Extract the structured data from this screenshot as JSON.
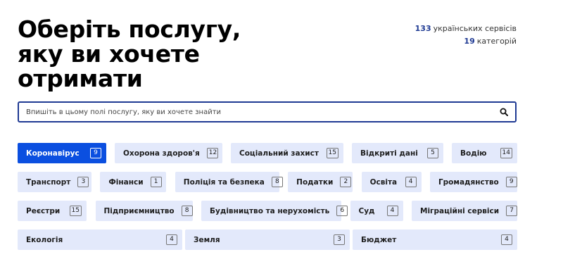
{
  "heading": {
    "line1": "Оберіть послугу,",
    "line2": "яку ви хочете",
    "line3": "отримати"
  },
  "stats": {
    "services_count": "133",
    "services_label": "українських сервісів",
    "categories_count": "19",
    "categories_label": "категорій"
  },
  "search": {
    "placeholder": "Впишіть в цьому полі послугу, яку ви хочете знайти",
    "value": "",
    "icon": "search-icon"
  },
  "colors": {
    "accent": "#0b4fe0",
    "chip_bg": "#e3e9fb",
    "search_border": "#1f3a93"
  },
  "categories": [
    {
      "label": "Коронавірус",
      "count": "9",
      "active": true
    },
    {
      "label": "Охорона здоров'я",
      "count": "12"
    },
    {
      "label": "Соціальний захист",
      "count": "15"
    },
    {
      "label": "Відкриті дані",
      "count": "5"
    },
    {
      "label": "Водію",
      "count": "14"
    },
    {
      "label": "Транспорт",
      "count": "3"
    },
    {
      "label": "Фінанси",
      "count": "1"
    },
    {
      "label": "Поліція та безпека",
      "count": "8"
    },
    {
      "label": "Податки",
      "count": "2"
    },
    {
      "label": "Освіта",
      "count": "4"
    },
    {
      "label": "Громадянство",
      "count": "9"
    },
    {
      "label": "Реєстри",
      "count": "15"
    },
    {
      "label": "Підприємництво",
      "count": "8"
    },
    {
      "label": "Будівництво та нерухомість",
      "count": "6"
    },
    {
      "label": "Суд",
      "count": "4"
    },
    {
      "label": "Міграційні сервіси",
      "count": "7"
    },
    {
      "label": "Екологія",
      "count": "4"
    },
    {
      "label": "Земля",
      "count": "3"
    },
    {
      "label": "Бюджет",
      "count": "4"
    }
  ]
}
